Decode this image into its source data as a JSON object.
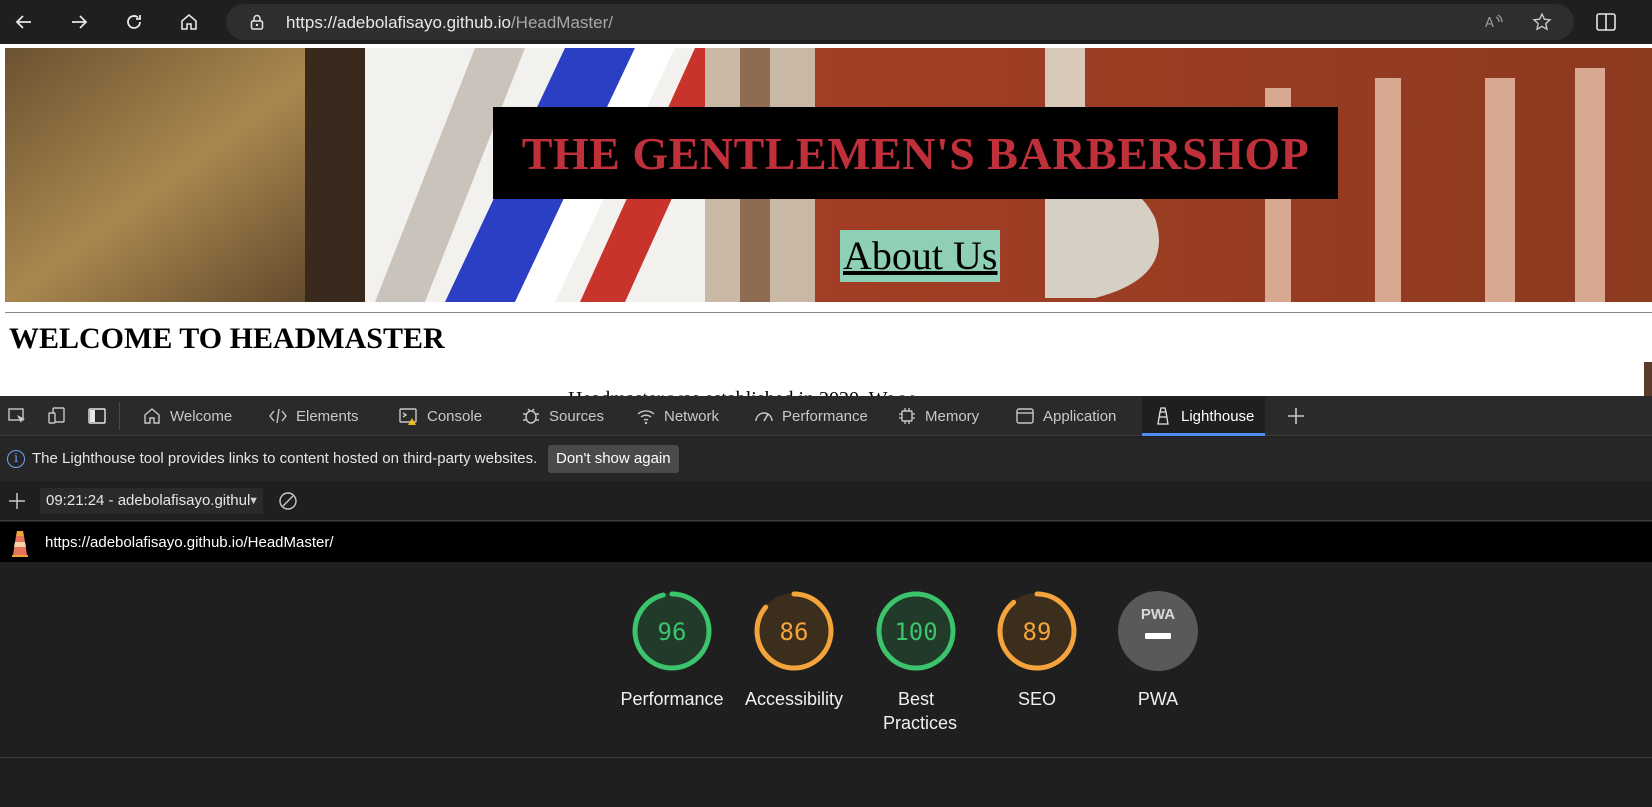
{
  "browser": {
    "url_host": "https://adebolafisayo.github.io",
    "url_path": "/HeadMaster/",
    "icons": [
      "back-arrow-icon",
      "forward-arrow-icon",
      "refresh-icon",
      "home-icon",
      "lock-icon",
      "read-aloud-icon",
      "favorite-star-icon",
      "split-screen-icon"
    ]
  },
  "page": {
    "hero_title": "THE GENTLEMEN'S BARBERSHOP",
    "about_link": "About Us",
    "welcome_heading": "WELCOME TO HEADMASTER",
    "cutoff_text": "Headmaster was established in 2020. We w..."
  },
  "devtools": {
    "tabs": [
      {
        "label": "Welcome",
        "icon": "home-icon"
      },
      {
        "label": "Elements",
        "icon": "code-icon"
      },
      {
        "label": "Console",
        "icon": "console-icon"
      },
      {
        "label": "Sources",
        "icon": "bug-icon"
      },
      {
        "label": "Network",
        "icon": "wifi-icon"
      },
      {
        "label": "Performance",
        "icon": "speedometer-icon"
      },
      {
        "label": "Memory",
        "icon": "chip-icon"
      },
      {
        "label": "Application",
        "icon": "window-icon"
      },
      {
        "label": "Lighthouse",
        "icon": "lighthouse-icon",
        "active": true
      }
    ],
    "info_text": "The Lighthouse tool provides links to content hosted on third-party websites.",
    "dont_show_label": "Don't show again",
    "report_select": "09:21:24 - adebolafisayo.githul",
    "report_url": "https://adebolafisayo.github.io/HeadMaster/",
    "colors": {
      "good": "#3bc46b",
      "average": "#f4a43a",
      "pwa": "#595959",
      "active_tab": "#4d8ef0"
    },
    "scores": [
      {
        "label": "Performance",
        "value": "96",
        "rating": "good"
      },
      {
        "label": "Accessibility",
        "value": "86",
        "rating": "average"
      },
      {
        "label": "Best Practices",
        "value": "100",
        "rating": "good"
      },
      {
        "label": "SEO",
        "value": "89",
        "rating": "average"
      },
      {
        "label": "PWA",
        "value": "",
        "rating": "pwa",
        "badge": "PWA"
      }
    ]
  }
}
